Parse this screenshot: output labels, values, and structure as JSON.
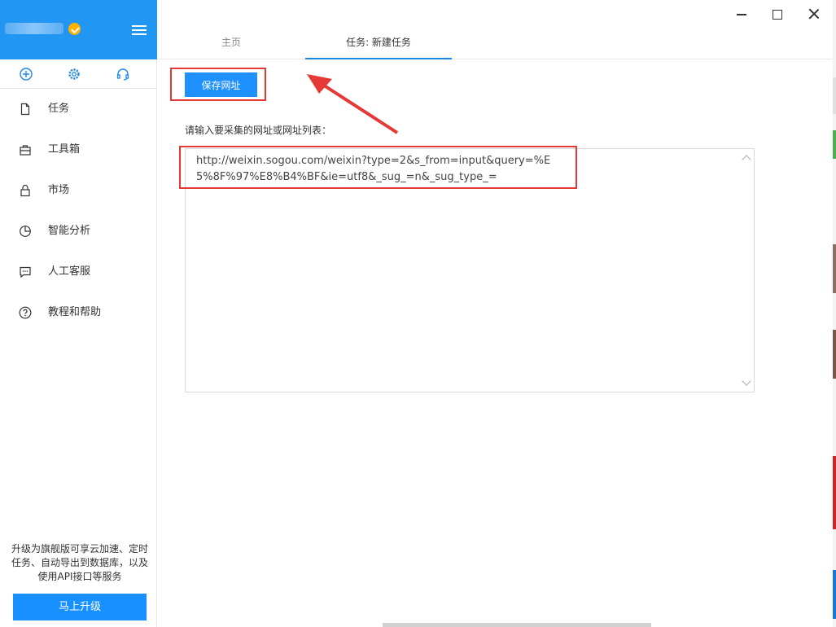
{
  "colors": {
    "accent": "#1e90ff",
    "sidebar_header": "#2196f3",
    "annotation": "#e53935"
  },
  "sidebar": {
    "username": "",
    "quick_icons": [
      "plus-circle-icon",
      "gear-icon",
      "headset-icon"
    ],
    "items": [
      {
        "label": "任务",
        "icon": "document-icon"
      },
      {
        "label": "工具箱",
        "icon": "toolbox-icon"
      },
      {
        "label": "市场",
        "icon": "lock-icon"
      },
      {
        "label": "智能分析",
        "icon": "pie-chart-icon"
      },
      {
        "label": "人工客服",
        "icon": "chat-icon"
      },
      {
        "label": "教程和帮助",
        "icon": "help-icon"
      }
    ],
    "promo_text": "升级为旗舰版可享云加速、定时任务、自动导出到数据库，以及使用API接口等服务",
    "upgrade_label": "马上升级"
  },
  "tabs": [
    {
      "label": "主页",
      "active": false
    },
    {
      "label": "任务: 新建任务",
      "active": true
    }
  ],
  "main": {
    "save_label": "保存网址",
    "prompt": "请输入要采集的网址或网址列表：",
    "url_value": "http://weixin.sogou.com/weixin?type=2&s_from=input&query=%E5%8F%97%E8%B4%BF&ie=utf8&_sug_=n&_sug_type_="
  }
}
